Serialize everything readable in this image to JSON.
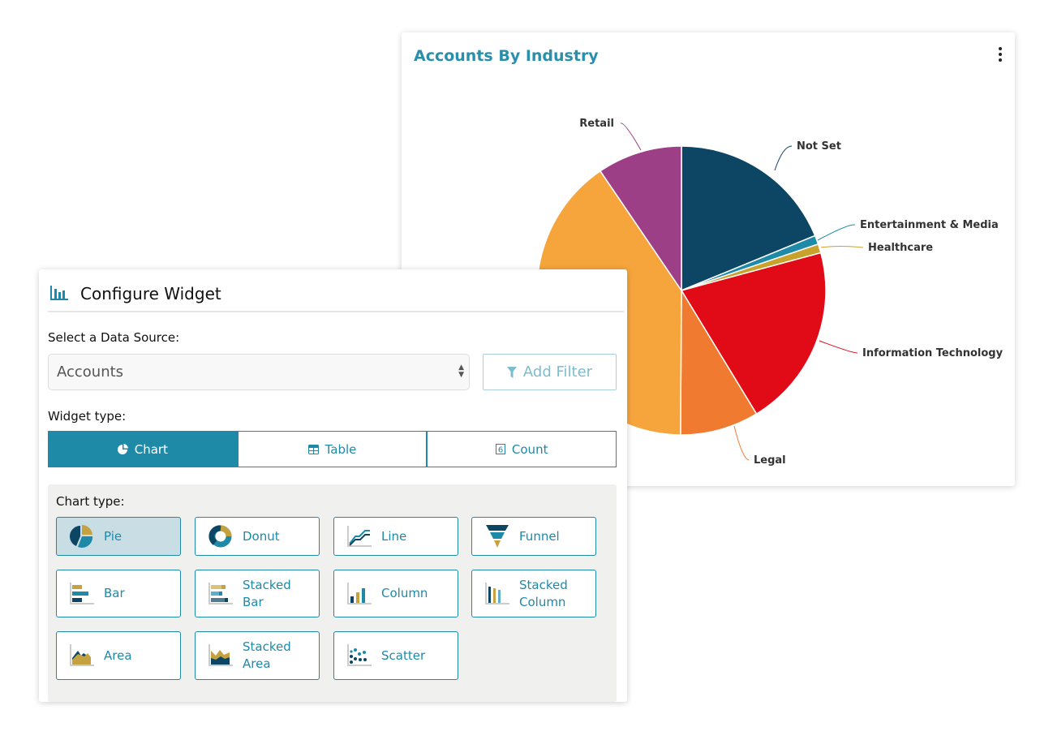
{
  "chart_card": {
    "title": "Accounts By Industry",
    "menu_icon": "kebab-menu-icon"
  },
  "chart_data": {
    "type": "pie",
    "title": "Accounts By Industry",
    "slices": [
      {
        "name": "Not Set",
        "value": 18.8,
        "color": "#0d4664"
      },
      {
        "name": "Entertainment & Media",
        "value": 1.0,
        "color": "#1e8aa8"
      },
      {
        "name": "Healthcare",
        "value": 1.0,
        "color": "#c9a22e"
      },
      {
        "name": "Information Technology",
        "value": 20.5,
        "color": "#e10a17"
      },
      {
        "name": "Legal",
        "value": 8.8,
        "color": "#ef7a30"
      },
      {
        "name": "",
        "value": 40.4,
        "color": "#f5a53c"
      },
      {
        "name": "Retail",
        "value": 9.5,
        "color": "#9c3f86"
      }
    ]
  },
  "panel": {
    "title": "Configure Widget",
    "data_source_label": "Select a Data Source:",
    "data_source_value": "Accounts",
    "add_filter": "Add Filter",
    "widget_type_label": "Widget type:",
    "widget_tabs": [
      "Chart",
      "Table",
      "Count"
    ],
    "selected_widget_tab": "Chart",
    "chart_type_label": "Chart type:",
    "chart_types": [
      "Pie",
      "Donut",
      "Line",
      "Funnel",
      "Stacked Bar",
      "Bar",
      "Column",
      "Stacked Column",
      "Area",
      "Stacked Area",
      "Scatter"
    ],
    "chart_type_labels": {
      "pie": "Pie",
      "donut": "Donut",
      "line": "Line",
      "funnel": "Funnel",
      "bar": "Bar",
      "stacked_bar": [
        "Stacked",
        "Bar"
      ],
      "column": "Column",
      "stacked_column": [
        "Stacked",
        "Column"
      ],
      "area": "Area",
      "stacked_area": [
        "Stacked",
        "Area"
      ],
      "scatter": "Scatter"
    },
    "selected_chart_type": "Pie",
    "count_icon_digit": "6"
  },
  "colors": {
    "accent": "#1e8aa8",
    "navy": "#0d4664",
    "gold": "#c5a240"
  }
}
